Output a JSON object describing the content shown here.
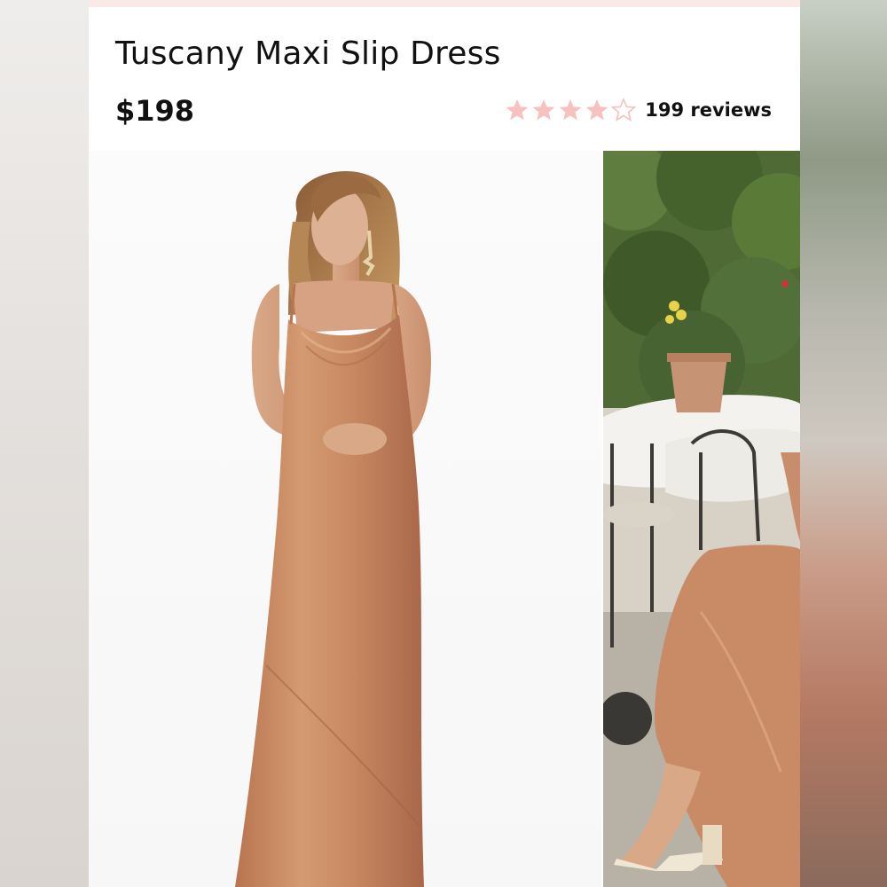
{
  "product": {
    "title": "Tuscany Maxi Slip Dress",
    "price": "$198",
    "rating": 4,
    "rating_max": 5,
    "reviews_label": "199 reviews"
  },
  "icons": {
    "star_filled": "star-icon",
    "star_empty": "star-outline-icon"
  },
  "colors": {
    "star": "#f6c1bf",
    "dress": "#c98a63",
    "accent_strip": "#fbe9e8"
  },
  "images": {
    "main": "product-photo-main",
    "side": "product-photo-lifestyle"
  }
}
